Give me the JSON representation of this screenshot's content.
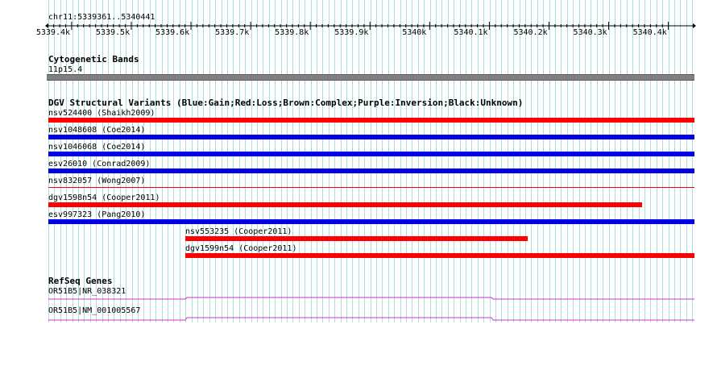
{
  "ruler": {
    "coords": "chr11:5339361..5340441",
    "ticks": [
      "5339.4k",
      "5339.5k",
      "5339.6k",
      "5339.7k",
      "5339.8k",
      "5339.9k",
      "5340k",
      "5340.1k",
      "5340.2k",
      "5340.3k",
      "5340.4k"
    ]
  },
  "cytoband": {
    "title": "Cytogenetic Bands",
    "band": "11p15.4"
  },
  "dgv": {
    "title": "DGV Structural Variants (Blue:Gain;Red:Loss;Brown:Complex;Purple:Inversion;Black:Unknown)",
    "items": [
      {
        "label": "nsv524400 (Shaikh2009)",
        "type": "loss"
      },
      {
        "label": "nsv1048608 (Coe2014)",
        "type": "gain"
      },
      {
        "label": "nsv1046068 (Coe2014)",
        "type": "gain"
      },
      {
        "label": "esv26010 (Conrad2009)",
        "type": "gain"
      },
      {
        "label": "nsv832057 (Wong2007)",
        "type": "loss"
      },
      {
        "label": "dgv1598n54 (Cooper2011)",
        "type": "loss"
      },
      {
        "label": "esv997323 (Pang2010)",
        "type": "gain"
      },
      {
        "label": "nsv553235 (Cooper2011)",
        "type": "loss"
      },
      {
        "label": "dgv1599n54 (Cooper2011)",
        "type": "loss"
      }
    ]
  },
  "refseq": {
    "title": "RefSeq Genes",
    "items": [
      {
        "label": "OR51B5|NR_038321"
      },
      {
        "label": "OR51B5|NM_001005567"
      }
    ]
  },
  "colors": {
    "gain": "#0000e6",
    "loss": "#ff0000",
    "gene": "#cc33cc",
    "grid": "#a8dede",
    "band": "#808080"
  }
}
